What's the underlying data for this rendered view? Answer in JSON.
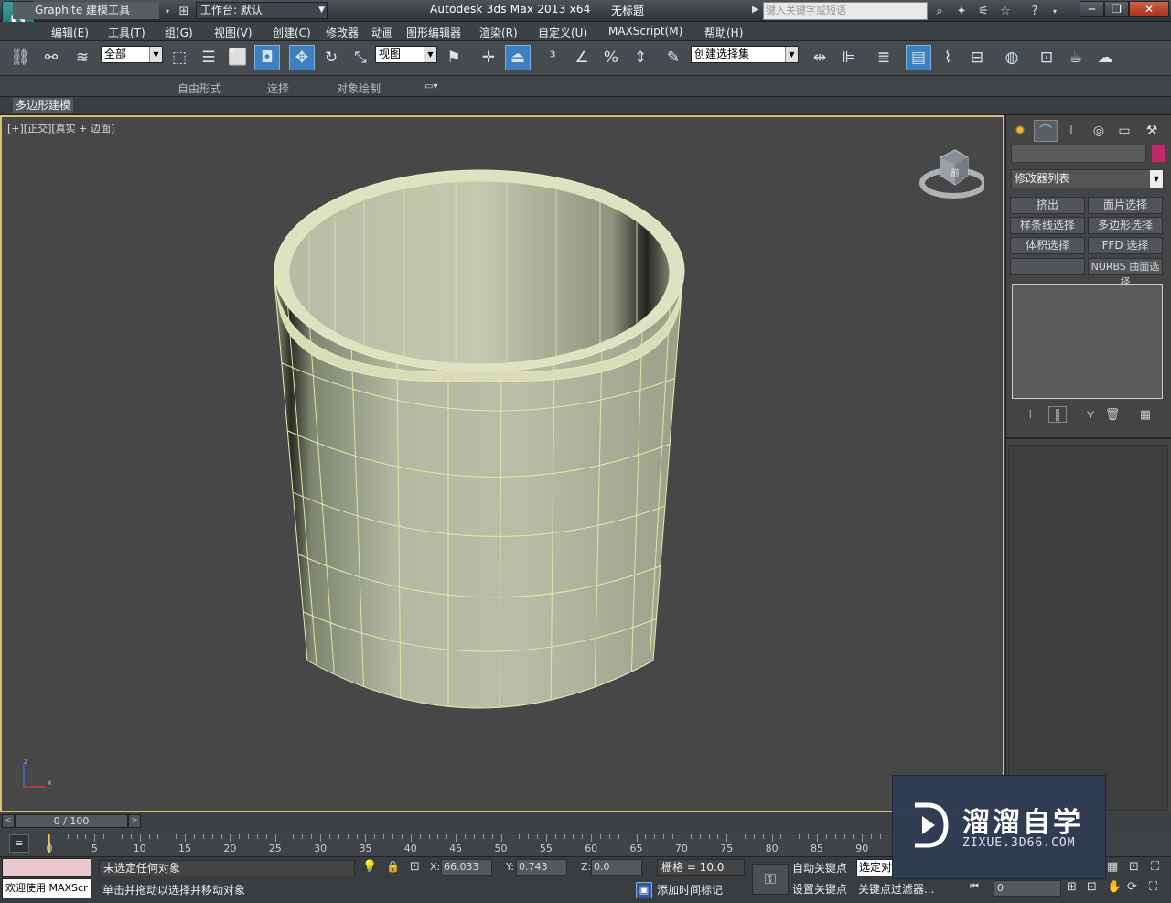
{
  "titlebar": {
    "workspace_label": "工作台: 默认",
    "app_title": "Autodesk 3ds Max  2013 x64",
    "file_title": "无标题",
    "search_placeholder": "键入关键字或短语"
  },
  "menu": [
    "编辑(E)",
    "工具(T)",
    "组(G)",
    "视图(V)",
    "创建(C)",
    "修改器",
    "动画",
    "图形编辑器",
    "渲染(R)",
    "自定义(U)",
    "MAXScript(M)",
    "帮助(H)"
  ],
  "toolbar": {
    "filter_value": "全部",
    "refcoord_value": "视图",
    "selset_value": "创建选择集"
  },
  "ribbon": {
    "tabs": [
      "Graphite 建模工具",
      "自由形式",
      "选择",
      "对象绘制"
    ],
    "subtab": "多边形建模"
  },
  "viewport": {
    "label": "[+][正交][真实 + 边面]",
    "viewcube_face": "前",
    "axis_labels": [
      "z",
      "x"
    ]
  },
  "command_panel": {
    "modifier_list": "修改器列表",
    "buttons": [
      "挤出",
      "面片选择",
      "样条线选择",
      "多边形选择",
      "体积选择",
      "FFD 选择",
      "",
      "NURBS 曲面选择"
    ],
    "accent_color": "#c2286e"
  },
  "timeslider": {
    "frame": "0 / 100",
    "ticks": [
      "0",
      "5",
      "10",
      "15",
      "20",
      "25",
      "30",
      "35",
      "40",
      "45",
      "50",
      "55",
      "60",
      "65",
      "70",
      "75",
      "80",
      "85",
      "90"
    ]
  },
  "status": {
    "welcome": "欢迎使用 MAXScr",
    "selection": "未选定任何对象",
    "prompt": "单击并拖动以选择并移动对象",
    "x": "66.033",
    "y": "0.743",
    "z": "0.0",
    "x_label": "X:",
    "y_label": "Y:",
    "z_label": "Z:",
    "grid": "栅格 = 10.0",
    "add_time_tag": "添加时间标记",
    "auto_key": "自动关键点",
    "set_key": "设置关键点",
    "selected": "选定对象",
    "key_filter": "关键点过滤器...",
    "frame_value": "0"
  },
  "watermark": {
    "title": "溜溜自学",
    "subtitle": "ZIXUE.3D66.COM"
  }
}
